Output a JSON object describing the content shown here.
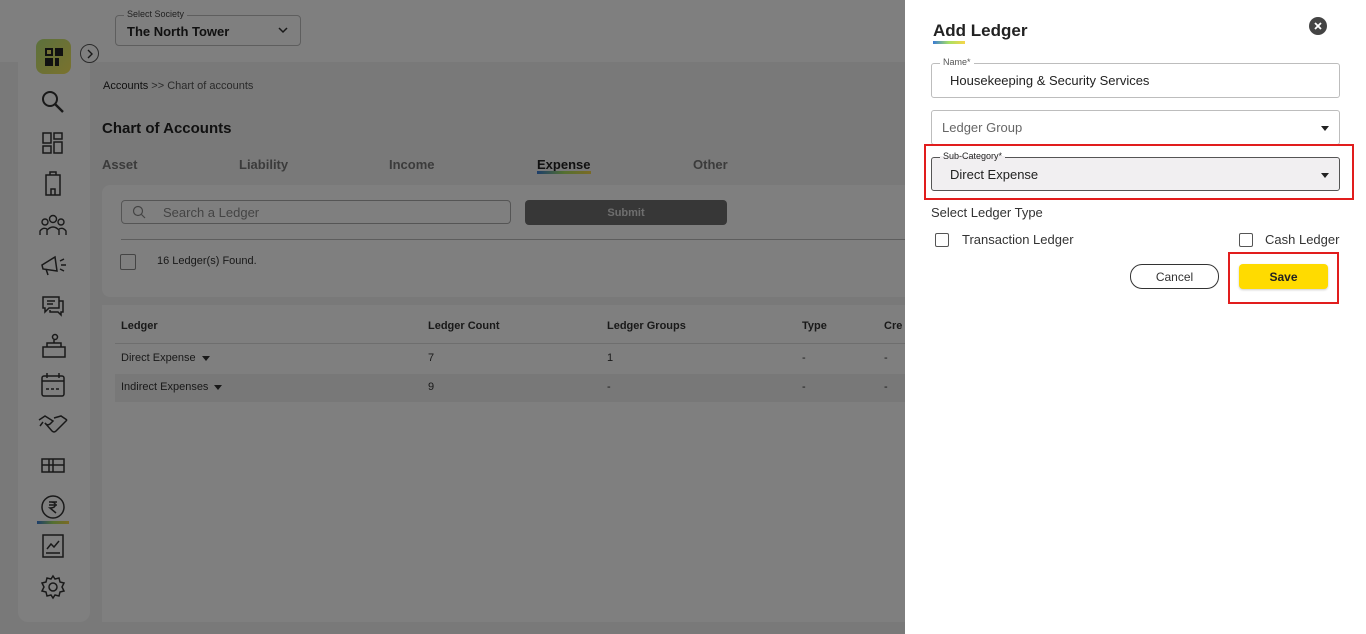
{
  "society": {
    "label": "Select Society",
    "value": "The North Tower"
  },
  "breadcrumb": {
    "root": "Accounts",
    "separator": " >> ",
    "current": "Chart of accounts"
  },
  "page": {
    "title": "Chart of Accounts"
  },
  "tabs": [
    {
      "label": "Asset"
    },
    {
      "label": "Liability"
    },
    {
      "label": "Income"
    },
    {
      "label": "Expense",
      "active": true
    },
    {
      "label": "Other"
    }
  ],
  "search": {
    "placeholder": "Search a Ledger",
    "submit_label": "Submit"
  },
  "results": {
    "count": "16",
    "suffix": " Ledger(s) Found."
  },
  "table": {
    "headers": [
      "Ledger",
      "Ledger Count",
      "Ledger Groups",
      "Type",
      "Cre"
    ],
    "rows": [
      {
        "ledger": "Direct Expense",
        "count": "7",
        "groups": "1",
        "type": "-",
        "created": "-"
      },
      {
        "ledger": "Indirect Expenses",
        "count": "9",
        "groups": "-",
        "type": "-",
        "created": "-"
      }
    ]
  },
  "sidebar_icons": [
    "search-icon",
    "dashboard-icon",
    "building-icon",
    "members-icon",
    "announcement-icon",
    "chat-icon",
    "facility-icon",
    "calendar-icon",
    "handshake-icon",
    "gift-icon",
    "rupee-icon",
    "report-icon",
    "settings-icon"
  ],
  "drawer": {
    "title": "Add Ledger",
    "name_label": "Name*",
    "name_value": "Housekeeping & Security Services",
    "group_placeholder": "Ledger Group",
    "subcategory_label": "Sub-Category*",
    "subcategory_value": "Direct Expense",
    "ledger_type_label": "Select Ledger Type",
    "transaction_label": "Transaction Ledger",
    "cash_label": "Cash Ledger",
    "cancel_label": "Cancel",
    "save_label": "Save"
  },
  "colors": {
    "accent_yellow": "#ffdb00",
    "highlight_red": "#e11d1d"
  }
}
